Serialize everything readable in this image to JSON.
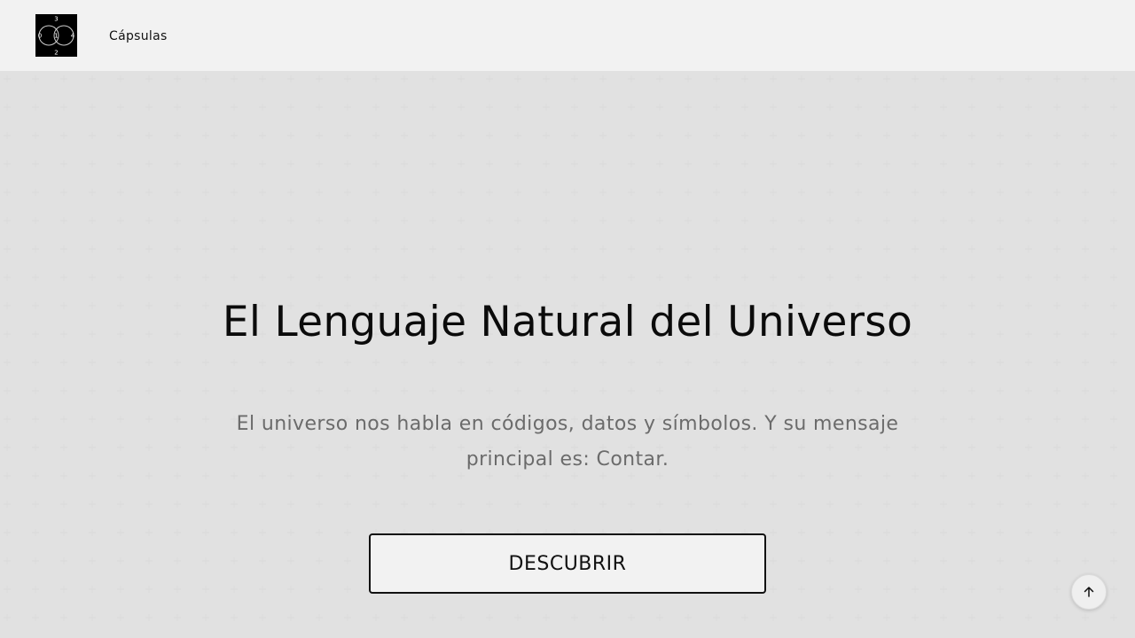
{
  "header": {
    "logo_digits": [
      "3",
      "0",
      "1",
      "4",
      "2"
    ],
    "nav": [
      {
        "label": "Cápsulas"
      }
    ]
  },
  "hero": {
    "title": "El Lenguaje Natural del Universo",
    "text": "El universo nos habla en códigos, datos y símbolos. Y su mensaje principal es: Contar.",
    "cta_label": "DESCUBRIR"
  },
  "icons": {
    "logo": "logo-icon",
    "scroll_top": "arrow-up-icon"
  },
  "colors": {
    "background": "#f7f7f7",
    "header": "#f2f2f2",
    "text": "#0b0b0b",
    "muted": "#6b6b6b"
  }
}
